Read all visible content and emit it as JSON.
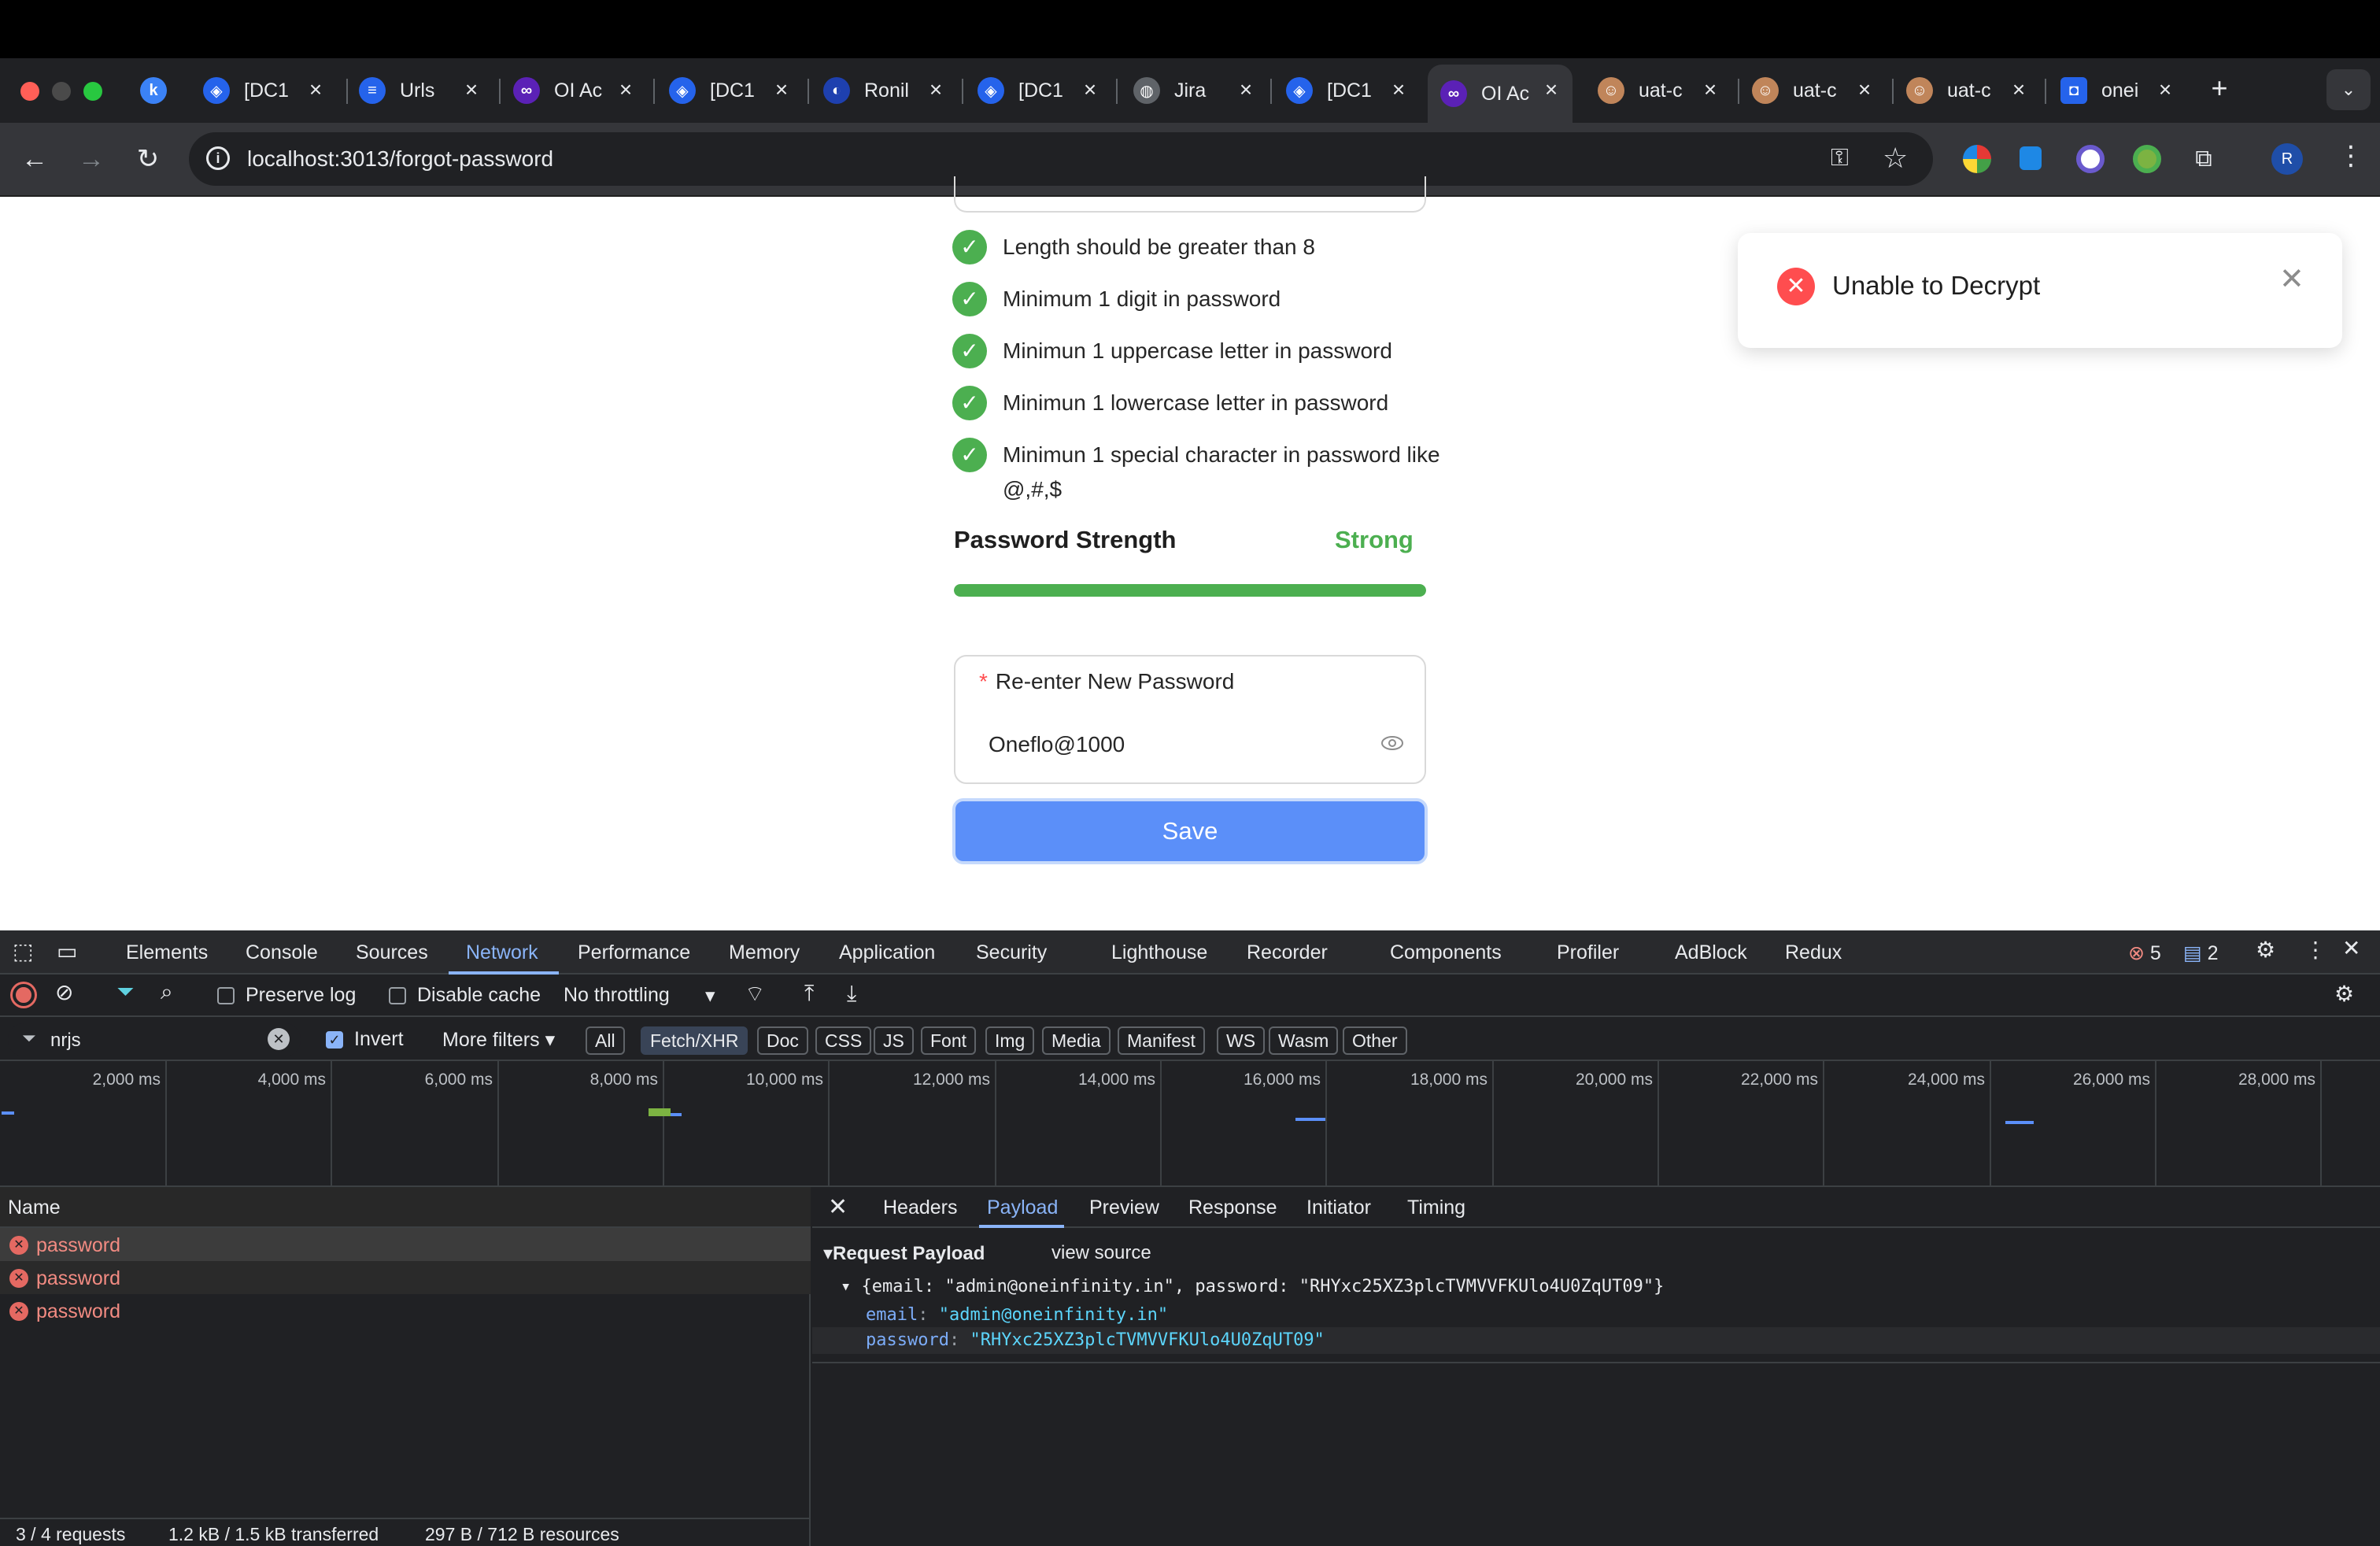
{
  "browser": {
    "tabs": [
      {
        "label": "",
        "icon": "k-icon",
        "color": "#3b82f6"
      },
      {
        "label": "[DC1",
        "icon": "app-icon",
        "color": "#2563eb"
      },
      {
        "label": "Urls",
        "icon": "list-icon",
        "color": "#2563eb"
      },
      {
        "label": "OI Ac",
        "icon": "oi-icon",
        "color": "#5b21b6"
      },
      {
        "label": "[DC1",
        "icon": "app-icon",
        "color": "#2563eb"
      },
      {
        "label": "Ronil",
        "icon": "r-icon",
        "color": "#1e40af"
      },
      {
        "label": "[DC1",
        "icon": "app-icon",
        "color": "#2563eb"
      },
      {
        "label": "Jira",
        "icon": "globe-icon",
        "color": "#5f6368"
      },
      {
        "label": "[DC1",
        "icon": "app-icon",
        "color": "#2563eb"
      },
      {
        "label": "OI Ac",
        "icon": "oi-icon",
        "color": "#5b21b6"
      },
      {
        "label": "uat-c",
        "icon": "avatar-icon",
        "color": "#c0855a"
      },
      {
        "label": "uat-c",
        "icon": "avatar-icon",
        "color": "#c0855a"
      },
      {
        "label": "uat-c",
        "icon": "avatar-icon",
        "color": "#c0855a"
      },
      {
        "label": "onei",
        "icon": "shield-icon",
        "color": "#2563eb"
      }
    ],
    "url": "localhost:3013/forgot-password"
  },
  "page": {
    "rules": [
      "Length should be greater than 8",
      "Minimum 1 digit in password",
      "Minimun 1 uppercase letter in password",
      "Minimun 1 lowercase letter in password",
      "Minimun 1 special character in password like @,#,$"
    ],
    "strength_label": "Password Strength",
    "strength_value": "Strong",
    "strength_level": 1.0,
    "reenter_label": "Re-enter New Password",
    "required_mark": "*",
    "reenter_value": "Oneflo@1000",
    "save_label": "Save",
    "toast_message": "Unable to Decrypt"
  },
  "devtools": {
    "tabs": [
      "Elements",
      "Console",
      "Sources",
      "Network",
      "Performance",
      "Memory",
      "Application",
      "Security",
      "Lighthouse",
      "Recorder",
      "Components",
      "Profiler",
      "AdBlock",
      "Redux"
    ],
    "active_tab": "Network",
    "error_count": "5",
    "message_count": "2",
    "preserve_log": "Preserve log",
    "disable_cache": "Disable cache",
    "throttling": "No throttling",
    "filter_value": "nrjs",
    "invert_label": "Invert",
    "more_filters": "More filters",
    "type_chips": [
      "All",
      "Fetch/XHR",
      "Doc",
      "CSS",
      "JS",
      "Font",
      "Img",
      "Media",
      "Manifest",
      "WS",
      "Wasm",
      "Other"
    ],
    "selected_chip": "Fetch/XHR",
    "timeline_ticks": [
      "2,000 ms",
      "4,000 ms",
      "6,000 ms",
      "8,000 ms",
      "10,000 ms",
      "12,000 ms",
      "14,000 ms",
      "16,000 ms",
      "18,000 ms",
      "20,000 ms",
      "22,000 ms",
      "24,000 ms",
      "26,000 ms",
      "28,000 ms"
    ],
    "name_header": "Name",
    "requests": [
      "password",
      "password",
      "password"
    ],
    "status": {
      "requests": "3 / 4 requests",
      "transferred": "1.2 kB / 1.5 kB transferred",
      "resources": "297 B / 712 B resources"
    },
    "detail_tabs": [
      "Headers",
      "Payload",
      "Preview",
      "Response",
      "Initiator",
      "Timing"
    ],
    "active_detail_tab": "Payload",
    "payload_title": "Request Payload",
    "view_source": "view source",
    "payload_summary": "{email: \"admin@oneinfinity.in\", password: \"RHYxc25XZ3plcTVMVVFKUlo4U0ZqUT09\"}",
    "email_key": "email",
    "email_value": "\"admin@oneinfinity.in\"",
    "password_key": "password",
    "password_value": "\"RHYxc25XZ3plcTVMVVFKUlo4U0ZqUT09\""
  }
}
